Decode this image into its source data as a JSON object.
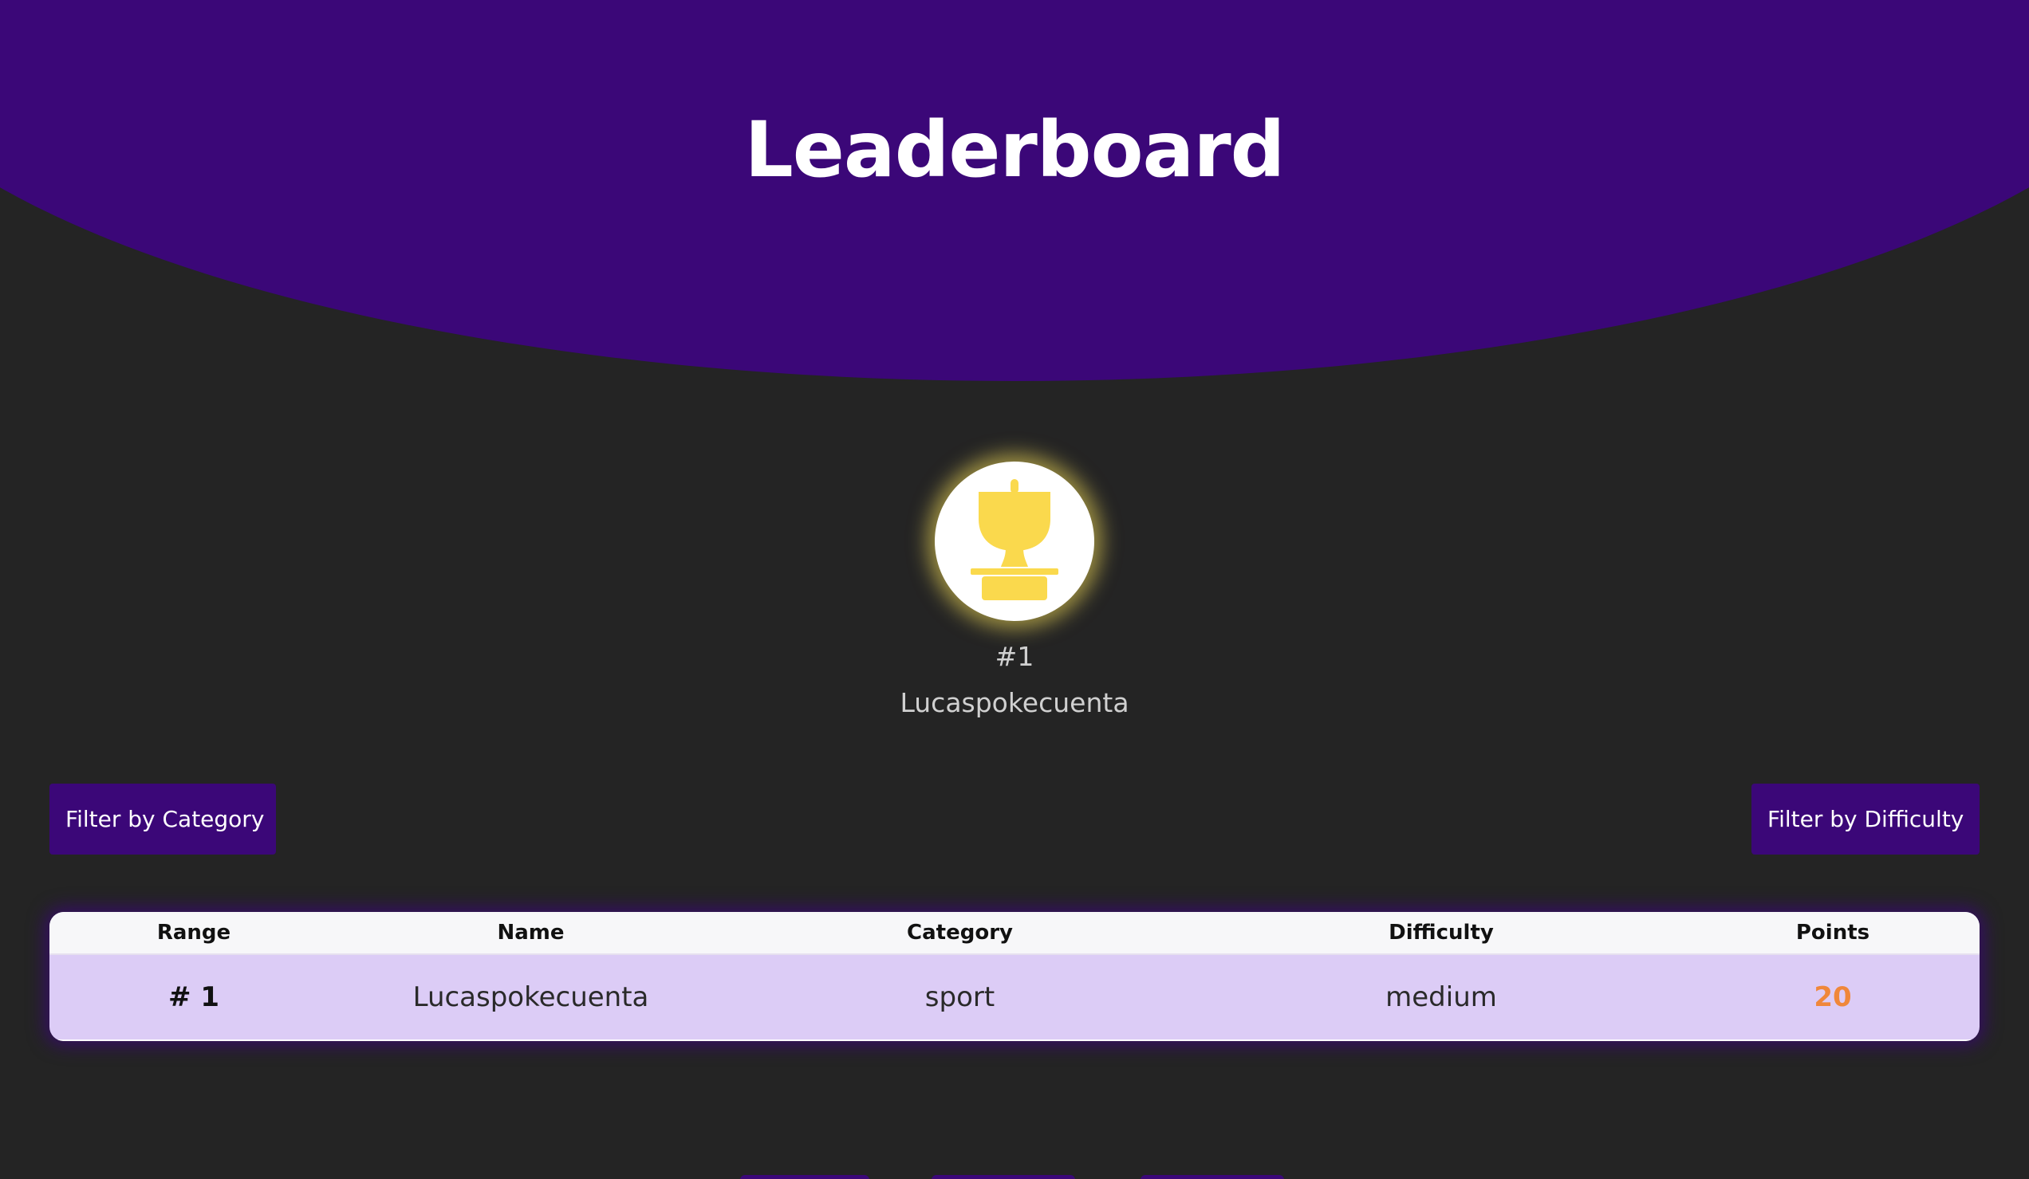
{
  "header": {
    "title": "Leaderboard"
  },
  "podium": {
    "rank": "#1",
    "name": "Lucaspokecuenta"
  },
  "filters": {
    "category_label": "Filter by Category",
    "difficulty_label": "Filter by Difficulty"
  },
  "table": {
    "headers": [
      "Range",
      "Name",
      "Category",
      "Difficulty",
      "Points"
    ],
    "rows": [
      {
        "rank": "# 1",
        "name": "Lucaspokecuenta",
        "category": "sport",
        "difficulty": "medium",
        "points": "20"
      }
    ]
  },
  "colors": {
    "brand": "#3b0778",
    "background": "#242424",
    "row": "#dcccf6",
    "trophy": "#fad94d",
    "points": "#f0873a"
  }
}
